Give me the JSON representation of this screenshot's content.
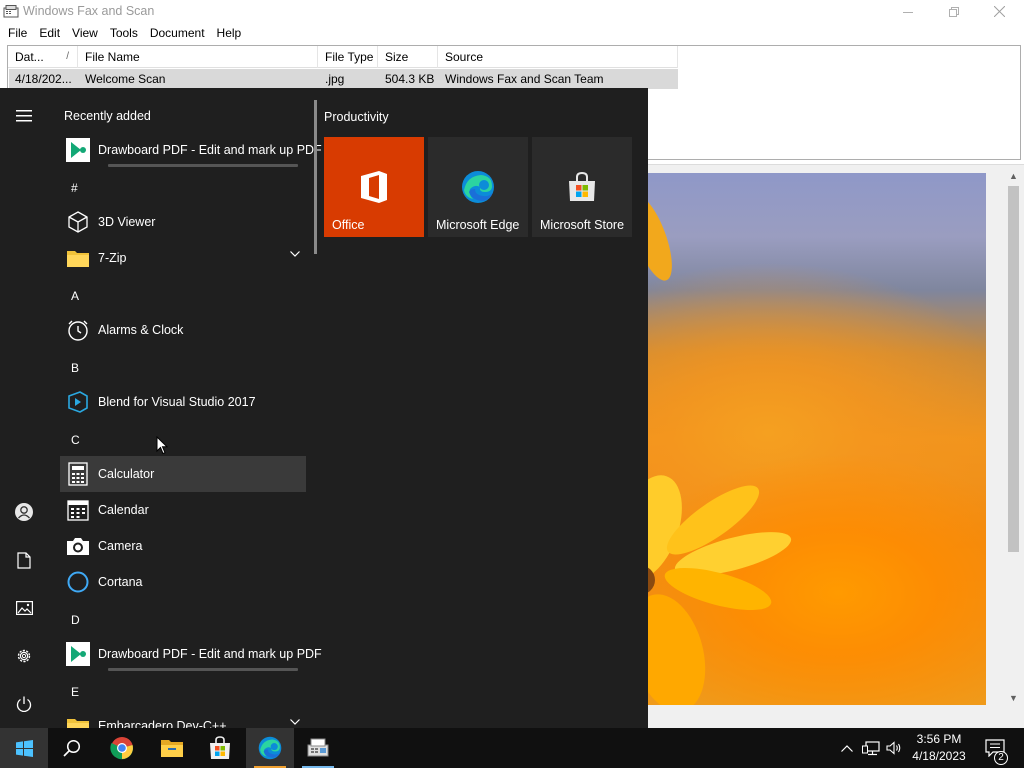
{
  "window": {
    "title": "Windows Fax and Scan",
    "menu": [
      "File",
      "Edit",
      "View",
      "Tools",
      "Document",
      "Help"
    ]
  },
  "list": {
    "columns": [
      "Dat...",
      "File Name",
      "File Type",
      "Size",
      "Source"
    ],
    "sort_indicator": "/",
    "rows": [
      {
        "date": "4/18/202...",
        "file_name": "Welcome Scan",
        "file_type": ".jpg",
        "size": "504.3 KB",
        "source": "Windows Fax and Scan Team"
      }
    ]
  },
  "start_menu": {
    "recently_added_title": "Recently added",
    "recent_app": {
      "label": "Drawboard PDF - Edit and mark up PDF",
      "icon": "drawboard-icon"
    },
    "groups": [
      {
        "letter": "#",
        "apps": [
          {
            "label": "3D Viewer",
            "icon": "cube-icon"
          },
          {
            "label": "7-Zip",
            "icon": "folder-icon",
            "expandable": true
          }
        ]
      },
      {
        "letter": "A",
        "apps": [
          {
            "label": "Alarms & Clock",
            "icon": "clock-icon"
          }
        ]
      },
      {
        "letter": "B",
        "apps": [
          {
            "label": "Blend for Visual Studio 2017",
            "icon": "blend-icon"
          }
        ]
      },
      {
        "letter": "C",
        "apps": [
          {
            "label": "Calculator",
            "icon": "calculator-icon"
          },
          {
            "label": "Calendar",
            "icon": "calendar-icon"
          },
          {
            "label": "Camera",
            "icon": "camera-icon"
          },
          {
            "label": "Cortana",
            "icon": "cortana-icon"
          }
        ]
      },
      {
        "letter": "D",
        "apps": [
          {
            "label": "Drawboard PDF - Edit and mark up PDF",
            "icon": "drawboard-icon"
          }
        ]
      },
      {
        "letter": "E",
        "apps": [
          {
            "label": "Embarcadero Dev-C++",
            "icon": "folder-icon",
            "expandable": true
          }
        ]
      }
    ],
    "tiles_title": "Productivity",
    "tiles": [
      {
        "label": "Office",
        "color": "#d83b01",
        "icon": "office-icon"
      },
      {
        "label": "Microsoft Edge",
        "color": "#2b2b2b",
        "icon": "edge-icon"
      },
      {
        "label": "Microsoft Store",
        "color": "#2b2b2b",
        "icon": "store-icon"
      }
    ],
    "rail_icons": [
      "hamburger-icon",
      "user-icon",
      "document-icon",
      "pictures-icon",
      "settings-icon",
      "power-icon"
    ]
  },
  "taskbar": {
    "apps": [
      "start-icon",
      "search-icon",
      "chrome-icon",
      "file-explorer-icon",
      "store-icon",
      "edge-icon",
      "fax-scan-icon"
    ],
    "time": "3:56 PM",
    "date": "4/18/2023",
    "notification_count": "2"
  },
  "colors": {
    "accent": "#76b9ed",
    "office_tile": "#d83b01",
    "start_bg": "#1f1f1f"
  }
}
